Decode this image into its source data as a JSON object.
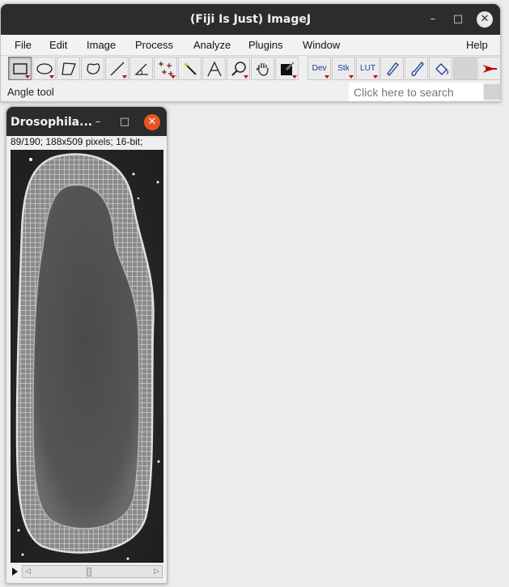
{
  "main_window": {
    "title": "(Fiji Is Just) ImageJ",
    "controls": {
      "minimize": "–",
      "maximize": "□",
      "close": "✕"
    }
  },
  "menu": {
    "items": [
      "File",
      "Edit",
      "Image",
      "Process",
      "Analyze",
      "Plugins",
      "Window"
    ],
    "help": "Help"
  },
  "toolbar": {
    "selected_tool": "rectangle",
    "text_tools": {
      "dev": "Dev",
      "stk": "Stk",
      "lut": "LUT"
    }
  },
  "status": {
    "text": "Angle tool",
    "search_placeholder": "Click here to search"
  },
  "image_window": {
    "title": "Drosophila...",
    "controls": {
      "minimize": "–",
      "maximize": "□",
      "close": "✕"
    },
    "info": "89/190; 188x509 pixels; 16-bit;",
    "slice_current": 89,
    "slice_total": 190
  },
  "colors": {
    "titlebar": "#2c2c2c",
    "close_accent": "#e95420",
    "toolbar_red": "#c00000"
  }
}
